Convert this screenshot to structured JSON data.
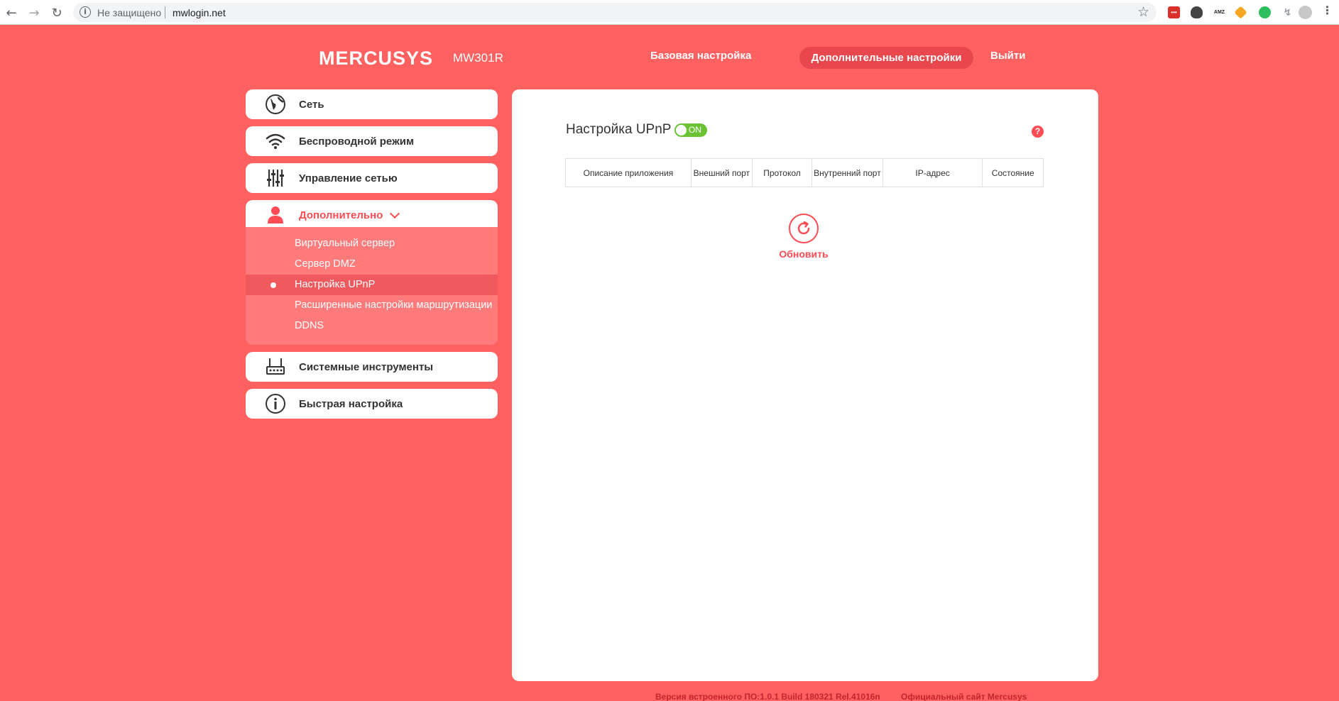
{
  "browser": {
    "back_icon": "arrow-left-icon",
    "forward_icon": "arrow-right-icon",
    "reload_icon": "reload-icon",
    "security_label": "Не защищено",
    "url": "mwlogin.net",
    "bookmark_icon": "star-icon"
  },
  "header": {
    "logo": "MERCUSYS",
    "model": "MW301R",
    "nav": {
      "basic": "Базовая настройка",
      "advanced": "Дополнительные настройки",
      "logout": "Выйти"
    }
  },
  "sidebar": {
    "items": [
      {
        "label": "Сеть",
        "icon": "globe-icon"
      },
      {
        "label": "Беспроводной режим",
        "icon": "wifi-icon"
      },
      {
        "label": "Управление сетью",
        "icon": "sliders-icon"
      },
      {
        "label": "Дополнительно",
        "icon": "user-icon"
      },
      {
        "label": "Системные инструменты",
        "icon": "router-icon"
      },
      {
        "label": "Быстрая настройка",
        "icon": "info-icon"
      }
    ],
    "submenu": [
      "Виртуальный сервер",
      "Сервер DMZ",
      "Настройка UPnP",
      "Расширенные настройки маршрутизации",
      "DDNS"
    ],
    "active_submenu": "Настройка UPnP"
  },
  "main": {
    "title": "Настройка UPnP",
    "toggle": "ON",
    "help": "?",
    "table": {
      "headers": [
        "Описание приложения",
        "Внешний порт",
        "Протокол",
        "Внутренний порт",
        "IP-адрес",
        "Состояние"
      ],
      "rows": []
    },
    "refresh_label": "Обновить"
  },
  "footer": {
    "version": "Версия встроенного ПО:1.0.1 Build 180321 Rel.41016n",
    "official_site": "Официальный сайт Mercusys"
  },
  "colors": {
    "background": "#ff6161",
    "accent": "#ff4c55",
    "toggle_on": "#6ac234"
  }
}
